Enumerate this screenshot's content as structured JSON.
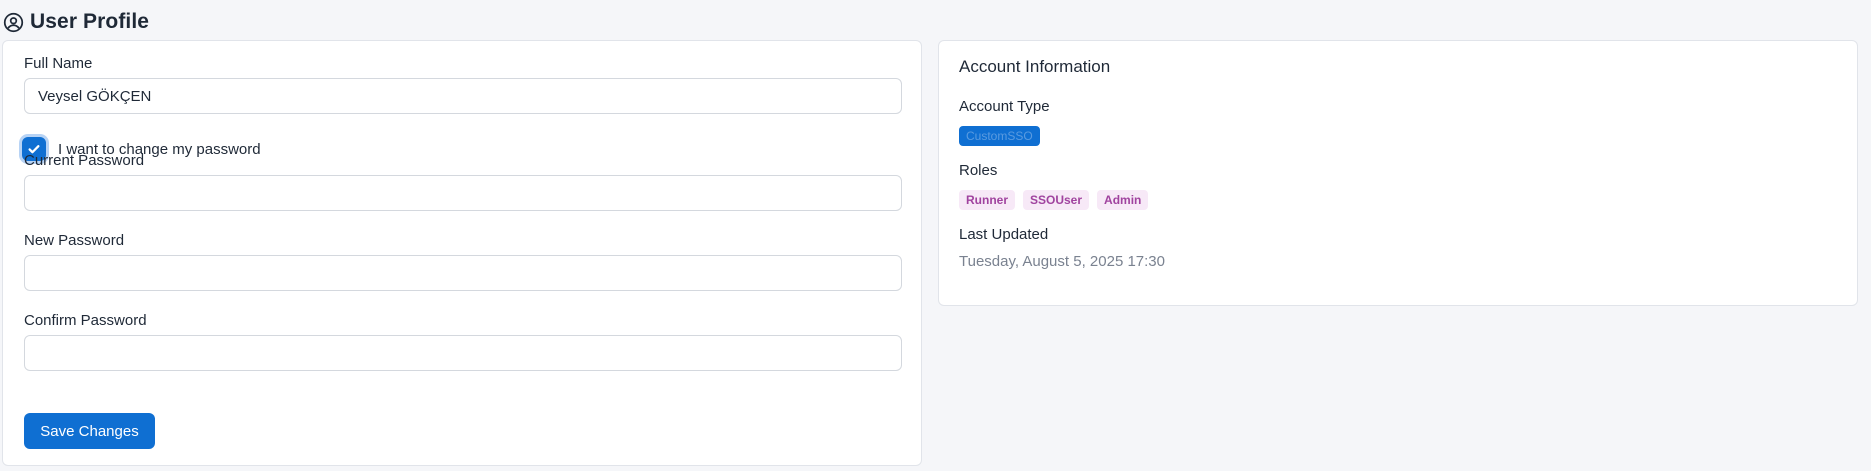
{
  "header": {
    "title": "User Profile",
    "icon": "user-circle-icon"
  },
  "form": {
    "full_name_label": "Full Name",
    "full_name_value": "Veysel GÖKÇEN",
    "change_password_checked": true,
    "change_password_label": "I want to change my password",
    "current_password_label": "Current Password",
    "current_password_value": "",
    "new_password_label": "New Password",
    "new_password_value": "",
    "confirm_password_label": "Confirm Password",
    "confirm_password_value": "",
    "save_label": "Save Changes"
  },
  "account": {
    "title": "Account Information",
    "type_label": "Account Type",
    "type_value": "CustomSSO",
    "roles_label": "Roles",
    "roles": [
      "Runner",
      "SSOUser",
      "Admin"
    ],
    "last_updated_label": "Last Updated",
    "last_updated_value": "Tuesday, August 5, 2025 17:30"
  },
  "colors": {
    "primary": "#0f6fd2",
    "page_background": "#f5f6f9",
    "role_badge_bg": "#f7e9f7",
    "role_badge_text": "#a0439f",
    "muted_text": "#7a8290"
  }
}
